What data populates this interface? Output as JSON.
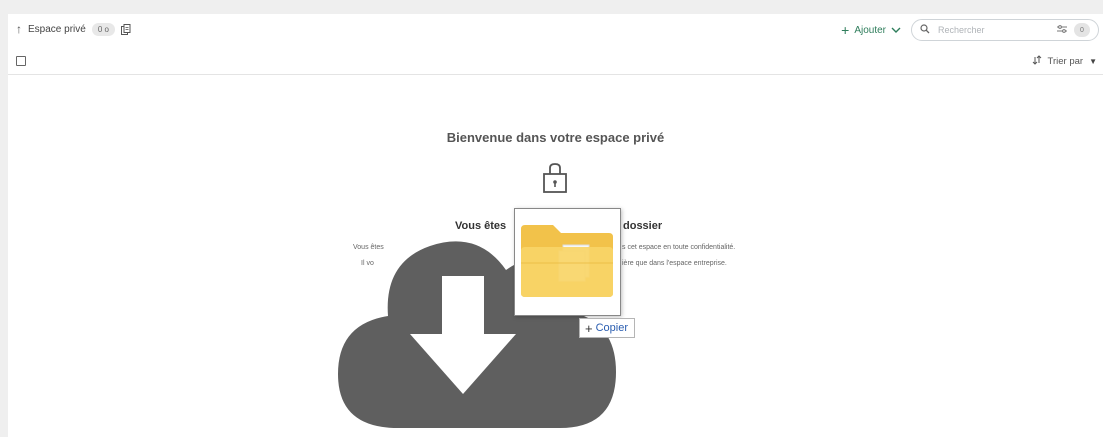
{
  "toolbar": {
    "breadcrumb": "Espace privé",
    "size_badge": "0 o",
    "add_label": "Ajouter",
    "search_placeholder": "Rechercher",
    "filter_count": "0"
  },
  "subbar": {
    "sort_label": "Trier par"
  },
  "empty_state": {
    "title": "Bienvenue dans votre espace privé",
    "heading_left": "Vous êtes",
    "heading_right": "dossier",
    "line1_left": "Vous êtes",
    "line1_right": "s cet espace en toute confidentialité.",
    "line2_left": "Il vo",
    "line2_right": "ière que dans l'espace entreprise."
  },
  "drag_overlay": {
    "copy_label": "Copier"
  },
  "icons": {
    "up_arrow": "arrow-up-icon",
    "clipboard": "clipboard-icon",
    "plus": "plus-icon",
    "chevron": "chevron-down-icon",
    "search": "search-icon",
    "filter": "filter-icon",
    "sort": "sort-icon",
    "lock": "lock-icon",
    "cloud_download": "cloud-download-icon",
    "folder": "folder-icon"
  },
  "colors": {
    "accent": "#2e7d5b",
    "copy_text": "#2a5db0",
    "cloud": "#5f5f5f"
  }
}
